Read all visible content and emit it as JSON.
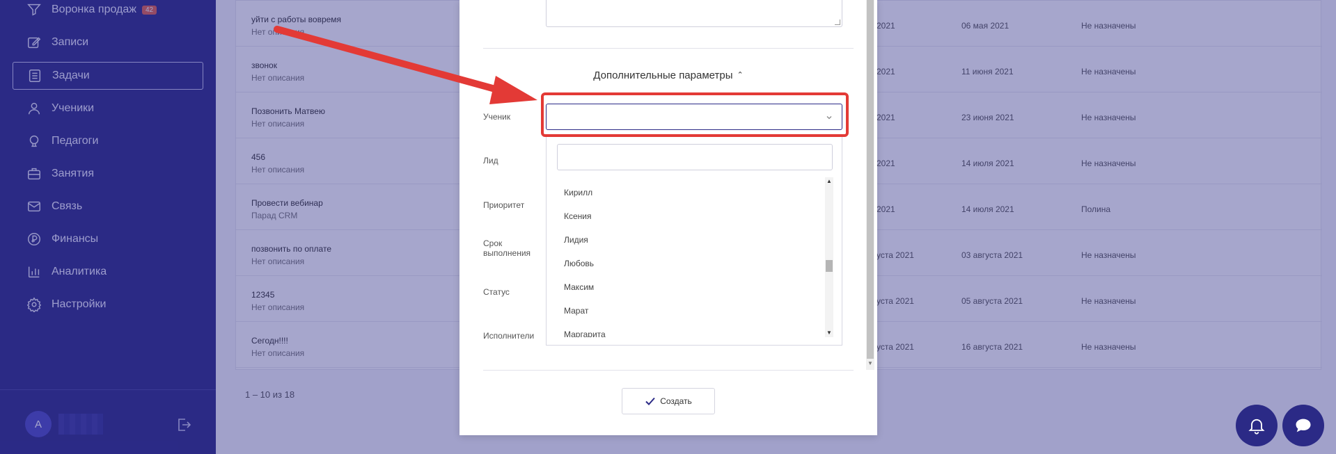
{
  "sidebar": {
    "items": [
      {
        "label": "Воронка продаж",
        "icon": "filter-icon",
        "badge": "42"
      },
      {
        "label": "Записи",
        "icon": "edit-note-icon"
      },
      {
        "label": "Задачи",
        "icon": "task-list-icon",
        "active": true
      },
      {
        "label": "Ученики",
        "icon": "user-icon"
      },
      {
        "label": "Педагоги",
        "icon": "teacher-icon"
      },
      {
        "label": "Занятия",
        "icon": "briefcase-icon"
      },
      {
        "label": "Связь",
        "icon": "mail-icon"
      },
      {
        "label": "Финансы",
        "icon": "ruble-coin-icon"
      },
      {
        "label": "Аналитика",
        "icon": "bar-chart-icon"
      },
      {
        "label": "Настройки",
        "icon": "gear-icon"
      }
    ],
    "user": {
      "avatar_letter": "A"
    }
  },
  "tasks": {
    "rows": [
      {
        "title": "уйти с работы вовремя",
        "desc": "Нет описания",
        "start": "2021",
        "end": "06 мая 2021",
        "exec": "Не назначены"
      },
      {
        "title": "звонок",
        "desc": "Нет описания",
        "start": "2021",
        "end": "11 июня 2021",
        "exec": "Не назначены"
      },
      {
        "title": "Позвонить Матвею",
        "desc": "Нет описания",
        "start": "2021",
        "end": "23 июня 2021",
        "exec": "Не назначены"
      },
      {
        "title": "456",
        "desc": "Нет описания",
        "start": "2021",
        "end": "14 июля 2021",
        "exec": "Не назначены"
      },
      {
        "title": "Провести вебинар",
        "desc": "Парад CRM",
        "start": "2021",
        "end": "14 июля 2021",
        "exec": "Полина"
      },
      {
        "title": "позвонить по оплате",
        "desc": "Нет описания",
        "start": "уста 2021",
        "end": "03 августа 2021",
        "exec": "Не назначены"
      },
      {
        "title": "12345",
        "desc": "Нет описания",
        "start": "уста 2021",
        "end": "05 августа 2021",
        "exec": "Не назначены"
      },
      {
        "title": "Сегодн!!!!",
        "desc": "Нет описания",
        "start": "уста 2021",
        "end": "16 августа 2021",
        "exec": "Не назначены"
      }
    ],
    "pagination": "1 – 10 из 18"
  },
  "modal": {
    "extra_params_label": "Дополнительные параметры",
    "fields": {
      "student": "Ученик",
      "lead": "Лид",
      "priority": "Приоритет",
      "deadline": "Срок выполнения",
      "status": "Статус",
      "executors": "Исполнители"
    },
    "student_value": "",
    "dropdown_search_value": "",
    "dropdown_options": [
      "Кирилл",
      "Ксения",
      "Лидия",
      "Любовь",
      "Максим",
      "Марат",
      "Маргарита"
    ],
    "create_label": "Создать"
  },
  "colors": {
    "sidebar": "#2b2a86",
    "accent": "#2b2a86",
    "highlight": "#e33a36",
    "badge": "#e0634f"
  }
}
